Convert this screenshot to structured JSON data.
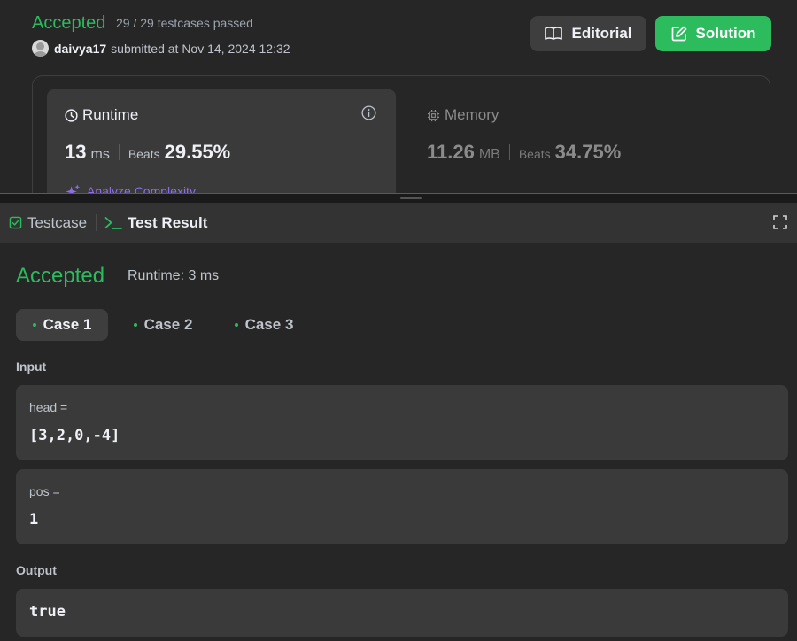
{
  "submission": {
    "status": "Accepted",
    "testcases": "29 / 29 testcases passed",
    "username": "daivya17",
    "submitted_text": "submitted at Nov 14, 2024 12:32",
    "editorial_label": "Editorial",
    "solution_label": "Solution"
  },
  "runtime": {
    "title": "Runtime",
    "value": "13",
    "unit": "ms",
    "beats_label": "Beats",
    "beats_value": "29.55%",
    "analyze_label": "Analyze Complexity"
  },
  "memory": {
    "title": "Memory",
    "value": "11.26",
    "unit": "MB",
    "beats_label": "Beats",
    "beats_value": "34.75%"
  },
  "tabs": {
    "testcase": "Testcase",
    "test_result": "Test Result"
  },
  "result": {
    "status": "Accepted",
    "runtime": "Runtime: 3 ms",
    "cases": [
      "Case 1",
      "Case 2",
      "Case 3"
    ],
    "input_label": "Input",
    "inputs": [
      {
        "name": "head =",
        "value": "[3,2,0,-4]"
      },
      {
        "name": "pos =",
        "value": "1"
      }
    ],
    "output_label": "Output",
    "output_value": "true"
  },
  "colors": {
    "accepted": "#2cbb5d",
    "background": "#262626",
    "panel": "#3a3a3a",
    "analyze": "#8c6cf0"
  }
}
